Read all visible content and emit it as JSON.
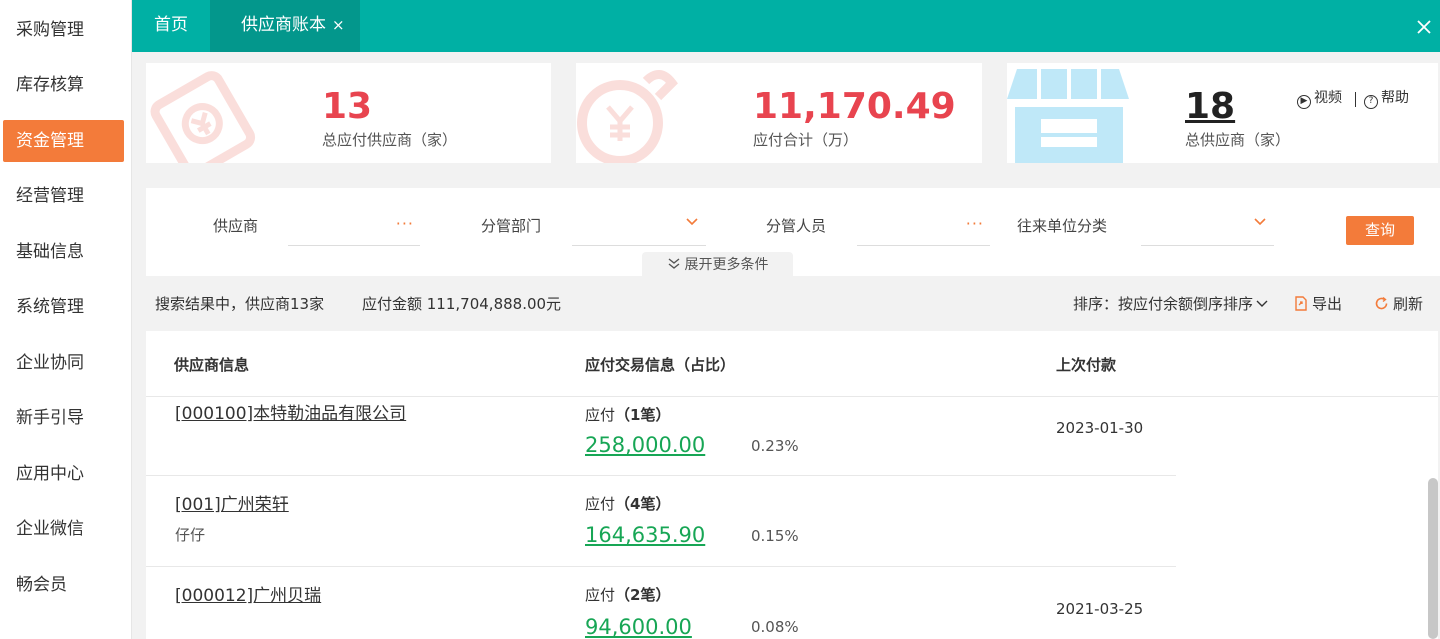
{
  "sidebar": {
    "items": [
      {
        "label": "采购管理"
      },
      {
        "label": "库存核算"
      },
      {
        "label": "资金管理",
        "active": true
      },
      {
        "label": "经营管理"
      },
      {
        "label": "基础信息"
      },
      {
        "label": "系统管理"
      },
      {
        "label": "企业协同"
      },
      {
        "label": "新手引导"
      },
      {
        "label": "应用中心"
      },
      {
        "label": "企业微信"
      },
      {
        "label": "畅会员"
      }
    ]
  },
  "topbar": {
    "tabs": [
      {
        "label": "首页"
      },
      {
        "label": "供应商账本",
        "close": "×"
      }
    ],
    "close_icon": "close-icon",
    "color": "#00b0a4"
  },
  "stats": [
    {
      "value": "13",
      "label": "总应付供应商（家）",
      "icon": "invoice-icon"
    },
    {
      "value": "11,170.49",
      "label": "应付合计（万）",
      "icon": "money-bag-icon"
    },
    {
      "value": "18",
      "label": "总供应商（家）",
      "icon": "store-icon"
    }
  ],
  "help": {
    "video": "视频",
    "help": "帮助"
  },
  "filters": {
    "supplier": "供应商",
    "department": "分管部门",
    "staff": "分管人员",
    "category": "往来单位分类",
    "query": "查询",
    "expand": "展开更多条件"
  },
  "results": {
    "summary": "搜索结果中，供应商13家",
    "amount": "应付金额 111,704,888.00元",
    "sort": "排序：按应付余额倒序排序",
    "export": "导出",
    "refresh": "刷新"
  },
  "table": {
    "headers": [
      "供应商信息",
      "应付交易信息（占比）",
      "上次付款"
    ],
    "rows": [
      {
        "name": "[000100]本特勒油品有限公司",
        "sub": "",
        "pay_prefix": "应付",
        "count": "（1笔）",
        "amount": "258,000.00",
        "pct": "0.23%",
        "last": "2023-01-30"
      },
      {
        "name": "[001]广州荣轩",
        "sub": "仔仔",
        "pay_prefix": "应付",
        "count": "（4笔）",
        "amount": "164,635.90",
        "pct": "0.15%",
        "last": ""
      },
      {
        "name": "[000012]广州贝瑞",
        "sub": "",
        "pay_prefix": "应付",
        "count": "（2笔）",
        "amount": "94,600.00",
        "pct": "0.08%",
        "last": "2021-03-25"
      }
    ]
  },
  "colors": {
    "accent": "#f37b3a",
    "teal": "#00b0a4",
    "red": "#e8444f",
    "green": "#17a655"
  }
}
